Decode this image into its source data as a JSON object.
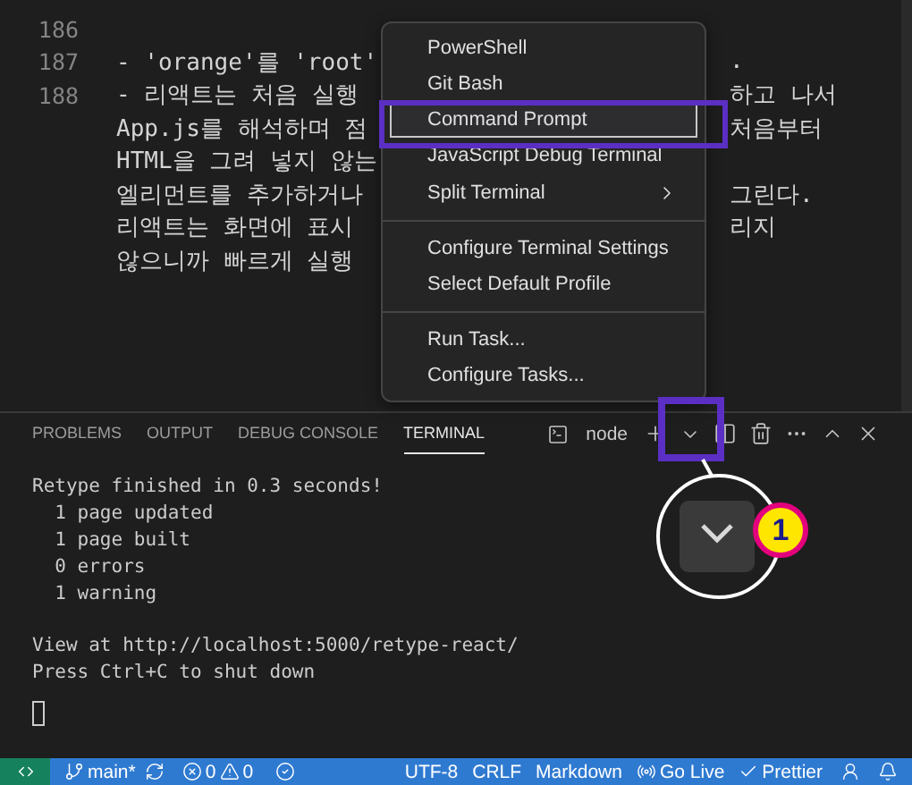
{
  "editor": {
    "lines": [
      {
        "number": "186"
      },
      {
        "number": "187",
        "left": "- 'orange'를 'root'",
        "right": "."
      },
      {
        "number": "188",
        "left": "- 리액트는 처음 실행",
        "right": "하고 나서"
      },
      {
        "left": "App.js를 해석하며 점",
        "right": "처음부터"
      },
      {
        "left": "HTML을 그려 넣지 않는"
      },
      {
        "left": "엘리먼트를 추가하거나",
        "right": "그린다."
      },
      {
        "left": "리액트는 화면에 표시",
        "right": "리지"
      },
      {
        "left": "않으니까 빠르게 실행"
      }
    ]
  },
  "menu": {
    "items": [
      {
        "kind": "item",
        "label": "PowerShell",
        "selected": false,
        "has_submenu": false
      },
      {
        "kind": "item",
        "label": "Git Bash",
        "selected": false,
        "has_submenu": false
      },
      {
        "kind": "item",
        "label": "Command Prompt",
        "selected": true,
        "has_submenu": false
      },
      {
        "kind": "item",
        "label": "JavaScript Debug Terminal",
        "selected": false,
        "has_submenu": false
      },
      {
        "kind": "item",
        "label": "Split Terminal",
        "selected": false,
        "has_submenu": true
      },
      {
        "kind": "separator"
      },
      {
        "kind": "item",
        "label": "Configure Terminal Settings",
        "selected": false,
        "has_submenu": false
      },
      {
        "kind": "item",
        "label": "Select Default Profile",
        "selected": false,
        "has_submenu": false
      },
      {
        "kind": "separator"
      },
      {
        "kind": "item",
        "label": "Run Task...",
        "selected": false,
        "has_submenu": false
      },
      {
        "kind": "item",
        "label": "Configure Tasks...",
        "selected": false,
        "has_submenu": false
      }
    ]
  },
  "panel": {
    "tabs": [
      {
        "label": "PROBLEMS",
        "selected": false
      },
      {
        "label": "OUTPUT",
        "selected": false
      },
      {
        "label": "DEBUG CONSOLE",
        "selected": false
      },
      {
        "label": "TERMINAL",
        "selected": true
      }
    ],
    "profile": "node",
    "terminal_blocks": [
      [
        "Retype finished in 0.3 seconds!",
        "  1 page updated",
        "  1 page built",
        "  0 errors",
        "  1 warning"
      ],
      [
        "View at http://localhost:5000/retype-react/",
        "Press Ctrl+C to shut down"
      ]
    ]
  },
  "annotation": {
    "badge": "1"
  },
  "status_bar": {
    "branch": "main*",
    "errors": "0",
    "warnings": "0",
    "encoding": "UTF-8",
    "line_ending": "CRLF",
    "language": "Markdown",
    "live": "Go Live",
    "formatter": "Prettier"
  }
}
